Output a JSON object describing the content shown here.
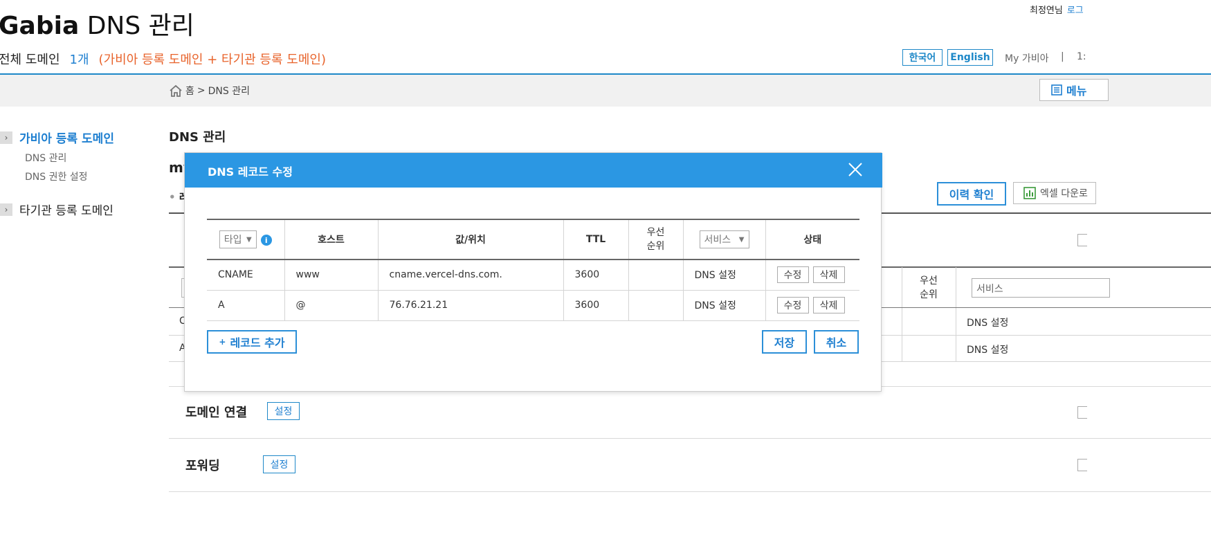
{
  "header": {
    "brand_name": "Gabia",
    "brand_suffix": "DNS 관리",
    "summary_label": "전체 도메인",
    "summary_count": "1개",
    "summary_note": "(가비아 등록 도메인 + 타기관 등록 도메인)",
    "user_name": "최정연님",
    "logout": "로그",
    "lang_korean": "한국어",
    "lang_english": "English",
    "my_gabia": "My 가비아",
    "separator": "|",
    "time": "1:"
  },
  "breadcrumb": {
    "home": "홈",
    "arrow": ">",
    "current": "DNS 관리",
    "menu_button": "메뉴"
  },
  "sidebar": {
    "cat1": "가비아 등록 도메인",
    "sub1": "DNS 관리",
    "sub2": "DNS 권한 설정",
    "cat2": "타기관 등록 도메인"
  },
  "main": {
    "page_title": "DNS 관리",
    "domain_partial": "my",
    "bullet_partial": "레",
    "history_button": "이력 확인",
    "excel_button": "엑셀 다운로",
    "bg_header_priority": "우선\n순위",
    "bg_service_select": "서비스",
    "bg_row1_type": "C",
    "bg_row2_type": "A",
    "bg_row1_service": "DNS 설정",
    "bg_row2_service": "DNS 설정",
    "domain_connect_title": "도메인 연결",
    "forwarding_title": "포워딩",
    "setting_label": "설정"
  },
  "modal": {
    "title": "DNS 레코드 수정",
    "columns": {
      "type_select": "타입",
      "host": "호스트",
      "value": "값/위치",
      "ttl": "TTL",
      "priority": "우선\n순위",
      "service_select": "서비스",
      "status": "상태"
    },
    "rows": [
      {
        "type": "CNAME",
        "host": "www",
        "value": "cname.vercel-dns.com.",
        "ttl": "3600",
        "priority": "",
        "service": "DNS 설정",
        "edit": "수정",
        "delete": "삭제"
      },
      {
        "type": "A",
        "host": "@",
        "value": "76.76.21.21",
        "ttl": "3600",
        "priority": "",
        "service": "DNS 설정",
        "edit": "수정",
        "delete": "삭제"
      }
    ],
    "add_record_plus": "+",
    "add_record": "레코드 추가",
    "save": "저장",
    "cancel": "취소"
  },
  "colors": {
    "accent": "#2b97e3",
    "link_blue": "#1e7fd0",
    "note_orange": "#e8632b",
    "bar_gray": "#f1f1f1"
  }
}
